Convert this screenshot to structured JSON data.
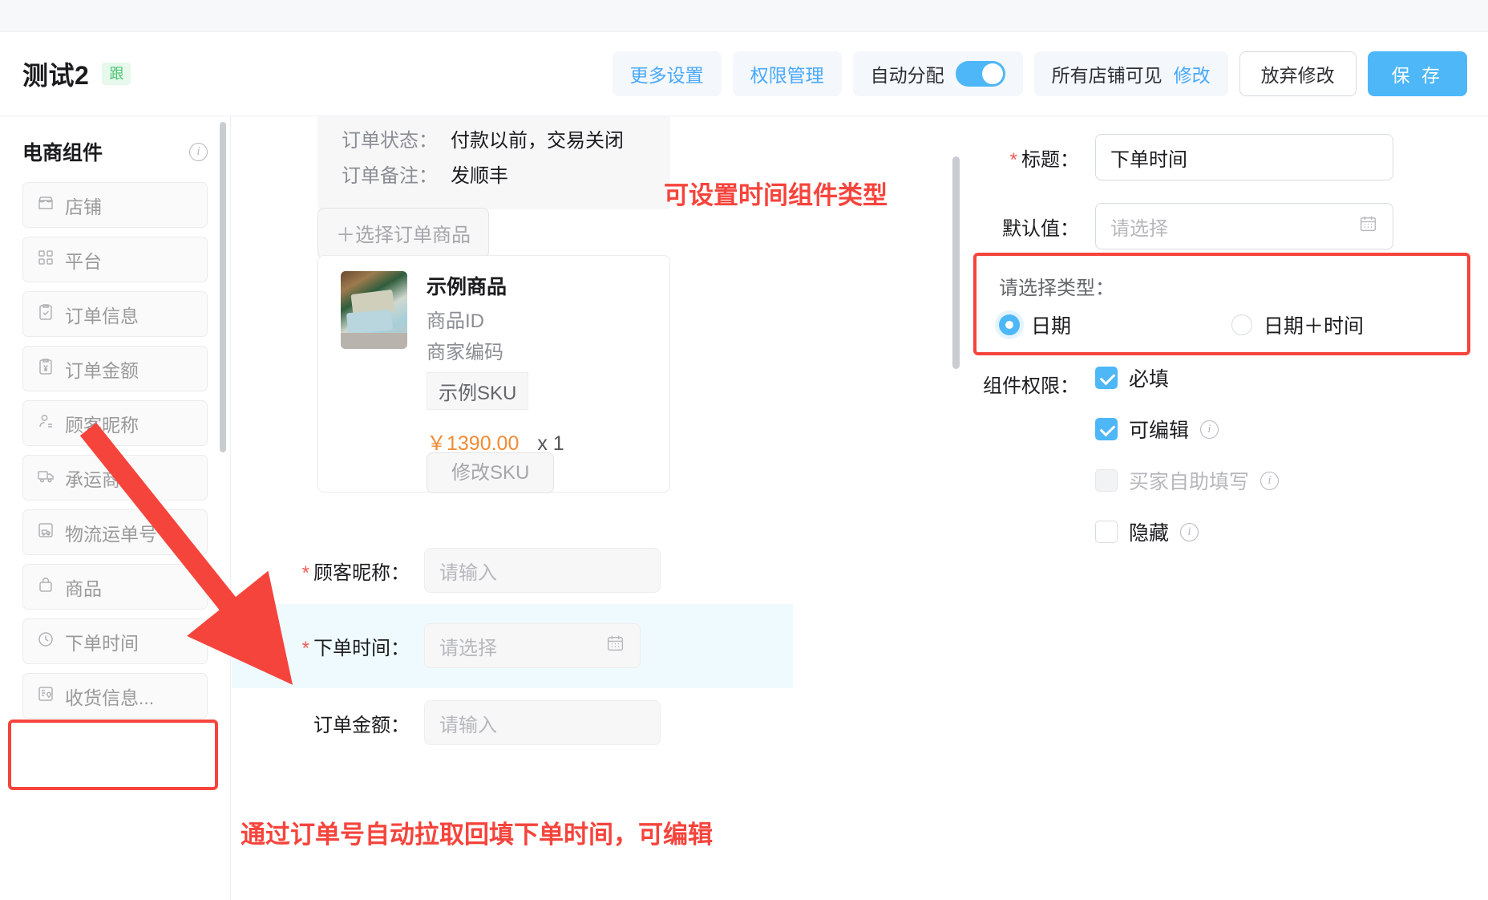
{
  "header": {
    "title": "测试2",
    "tag": "跟",
    "more_settings": "更多设置",
    "permission_manage": "权限管理",
    "auto_assign": "自动分配",
    "visibility": "所有店铺可见",
    "visibility_edit": "修改",
    "discard": "放弃修改",
    "save": "保 存",
    "accent_color": "#4db7f8"
  },
  "sidebar": {
    "title": "电商组件",
    "info_icon": "info-icon",
    "items": [
      {
        "label": "店铺",
        "icon": "shop-icon"
      },
      {
        "label": "平台",
        "icon": "grid-icon"
      },
      {
        "label": "订单信息",
        "icon": "clipboard-check-icon"
      },
      {
        "label": "订单金额",
        "icon": "yen-clipboard-icon"
      },
      {
        "label": "顾客昵称",
        "icon": "user-icon"
      },
      {
        "label": "承运商",
        "icon": "truck-icon"
      },
      {
        "label": "物流运单号",
        "icon": "shipping-note-icon"
      },
      {
        "label": "商品",
        "icon": "bag-icon"
      },
      {
        "label": "下单时间",
        "icon": "clock-icon"
      },
      {
        "label": "收货信息...",
        "icon": "address-icon"
      }
    ],
    "highlighted_item": "下单时间"
  },
  "middle": {
    "order_meta": [
      {
        "label": "订单状态：",
        "value": "付款以前，交易关闭"
      },
      {
        "label": "订单备注：",
        "value": "发顺丰"
      }
    ],
    "select_goods_button": "＋选择订单商品",
    "goods": {
      "name": "示例商品",
      "product_id_label": "商品ID",
      "merchant_code_label": "商家编码",
      "sku_tag": "示例SKU",
      "price": "￥1390.00",
      "quantity": "x 1",
      "price_color": "#f08b34",
      "edit_sku_button": "修改SKU"
    },
    "fields": [
      {
        "label": "顾客昵称：",
        "required": true,
        "placeholder": "请输入",
        "type": "text",
        "highlight": false
      },
      {
        "label": "下单时间：",
        "required": true,
        "placeholder": "请选择",
        "type": "date",
        "highlight": true
      },
      {
        "label": "订单金额：",
        "required": false,
        "placeholder": "请输入",
        "type": "text",
        "highlight": false
      }
    ]
  },
  "right": {
    "title_label": "标题：",
    "title_required": true,
    "title_value": "下单时间",
    "default_label": "默认值：",
    "default_placeholder": "请选择",
    "type_section_label": "请选择类型：",
    "type_options": [
      {
        "label": "日期",
        "selected": true
      },
      {
        "label": "日期＋时间",
        "selected": false
      }
    ],
    "permission_label": "组件权限：",
    "permissions": [
      {
        "label": "必填",
        "checked": true,
        "disabled": false,
        "has_info": false
      },
      {
        "label": "可编辑",
        "checked": true,
        "disabled": false,
        "has_info": true
      },
      {
        "label": "买家自助填写",
        "checked": false,
        "disabled": true,
        "has_info": true
      },
      {
        "label": "隐藏",
        "checked": false,
        "disabled": false,
        "has_info": true
      }
    ]
  },
  "annotations": {
    "top": "可设置时间组件类型",
    "bottom": "通过订单号自动拉取回填下单时间，可编辑",
    "color": "#f5443c"
  }
}
